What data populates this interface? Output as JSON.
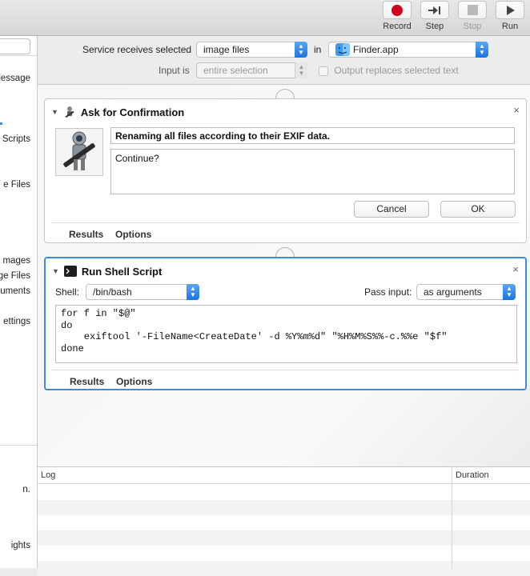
{
  "toolbar": {
    "record": "Record",
    "step": "Step",
    "stop": "Stop",
    "run": "Run"
  },
  "sidebar": {
    "items": [
      "lessage",
      "Scripts",
      "e Files",
      "mages",
      "ge Files",
      "uments",
      "ettings"
    ],
    "lower_items": [
      "n.",
      "ights"
    ]
  },
  "service": {
    "receives_label": "Service receives selected",
    "receives_value": "image files",
    "in_label": "in",
    "app_value": "Finder.app",
    "input_label": "Input is",
    "input_value": "entire selection",
    "output_replaces_label": "Output replaces selected text"
  },
  "actions": [
    {
      "title": "Ask for Confirmation",
      "message": "Renaming all files according to their EXIF data.",
      "sub_message": "Continue?",
      "cancel_label": "Cancel",
      "ok_label": "OK",
      "results_label": "Results",
      "options_label": "Options"
    },
    {
      "title": "Run Shell Script",
      "shell_label": "Shell:",
      "shell_value": "/bin/bash",
      "pass_input_label": "Pass input:",
      "pass_input_value": "as arguments",
      "script": "for f in \"$@\"\ndo\n    exiftool '-FileName<CreateDate' -d %Y%m%d\" \"%H%M%S%%-c.%%e \"$f\"\ndone",
      "results_label": "Results",
      "options_label": "Options"
    }
  ],
  "log": {
    "col_log": "Log",
    "col_duration": "Duration"
  },
  "colors": {
    "accent": "#3b8de0",
    "record": "#d0021b"
  }
}
